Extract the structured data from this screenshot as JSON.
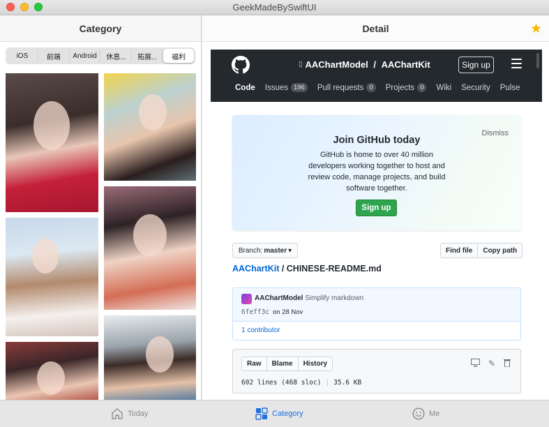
{
  "window": {
    "title": "GeekMadeBySwiftUI"
  },
  "sidebar": {
    "title": "Category",
    "segments": [
      {
        "label": "iOS"
      },
      {
        "label": "前端"
      },
      {
        "label": "Android"
      },
      {
        "label": "休息..."
      },
      {
        "label": "拓展..."
      },
      {
        "label": "福利"
      }
    ],
    "selected_segment": "福利"
  },
  "detail": {
    "title": "Detail",
    "favorite_icon": "star-icon",
    "favorite_color": "#f5b800"
  },
  "github": {
    "repo_owner": "AAChartModel",
    "repo_separator": " / ",
    "repo_name": "AAChartKit",
    "signup_label": "Sign up",
    "nav": [
      {
        "label": "Code",
        "count": ""
      },
      {
        "label": "Issues",
        "count": "196"
      },
      {
        "label": "Pull requests",
        "count": "0"
      },
      {
        "label": "Projects",
        "count": "0"
      },
      {
        "label": "Wiki",
        "count": ""
      },
      {
        "label": "Security",
        "count": ""
      },
      {
        "label": "Pulse",
        "count": ""
      }
    ],
    "join": {
      "dismiss": "Dismiss",
      "heading": "Join GitHub today",
      "body": "GitHub is home to over 40 million developers working together to host and review code, manage projects, and build software together.",
      "button": "Sign up"
    },
    "branch": {
      "prefix": "Branch:",
      "name": "master"
    },
    "file_buttons": {
      "find": "Find file",
      "copy": "Copy path"
    },
    "breadcrumb": {
      "repo": "AAChartKit",
      "separator": " / ",
      "file": "CHINESE-README.md"
    },
    "commit": {
      "author": "AAChartModel",
      "message": "Simplify markdown",
      "sha": "6feff3c",
      "date": "on 28 Nov",
      "contributors": "1 contributor"
    },
    "file": {
      "buttons": [
        "Raw",
        "Blame",
        "History"
      ],
      "lines": "602 lines (468 sloc)",
      "size": "35.6 KB"
    }
  },
  "tabbar": {
    "tabs": [
      {
        "label": "Today",
        "icon": "house-icon"
      },
      {
        "label": "Category",
        "icon": "grid-icon"
      },
      {
        "label": "Me",
        "icon": "smile-icon"
      }
    ],
    "active": "Category",
    "active_color": "#1f6fe0"
  }
}
